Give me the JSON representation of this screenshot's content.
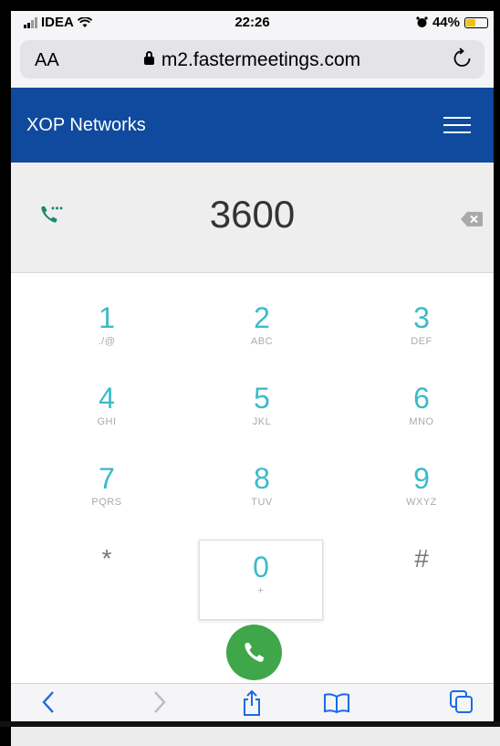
{
  "status": {
    "carrier": "IDEA",
    "time": "22:26",
    "battery": "44%",
    "battery_level": 0.44
  },
  "browser": {
    "aa_label": "AA",
    "url": "m2.fastermeetings.com"
  },
  "app": {
    "brand": "XOP Networks"
  },
  "dialer": {
    "number": "3600",
    "keys": [
      {
        "digit": "1",
        "letters": "./@"
      },
      {
        "digit": "2",
        "letters": "ABC"
      },
      {
        "digit": "3",
        "letters": "DEF"
      },
      {
        "digit": "4",
        "letters": "GHI"
      },
      {
        "digit": "5",
        "letters": "JKL"
      },
      {
        "digit": "6",
        "letters": "MNO"
      },
      {
        "digit": "7",
        "letters": "PQRS"
      },
      {
        "digit": "8",
        "letters": "TUV"
      },
      {
        "digit": "9",
        "letters": "WXYZ"
      },
      {
        "digit": "*",
        "letters": ""
      },
      {
        "digit": "0",
        "letters": "+"
      },
      {
        "digit": "#",
        "letters": ""
      }
    ]
  },
  "colors": {
    "appbar": "#0f4a9e",
    "digit": "#3bbcc8",
    "call_button": "#3fa64a",
    "phone_icon": "#1a8a6e"
  },
  "icons": {
    "phone": "phone-dots-icon",
    "backspace": "backspace-icon",
    "call": "phone-icon",
    "menu": "hamburger-menu-icon",
    "back": "chevron-left-icon",
    "forward": "chevron-right-icon",
    "share": "share-icon",
    "bookmarks": "book-icon",
    "tabs": "tabs-icon"
  }
}
